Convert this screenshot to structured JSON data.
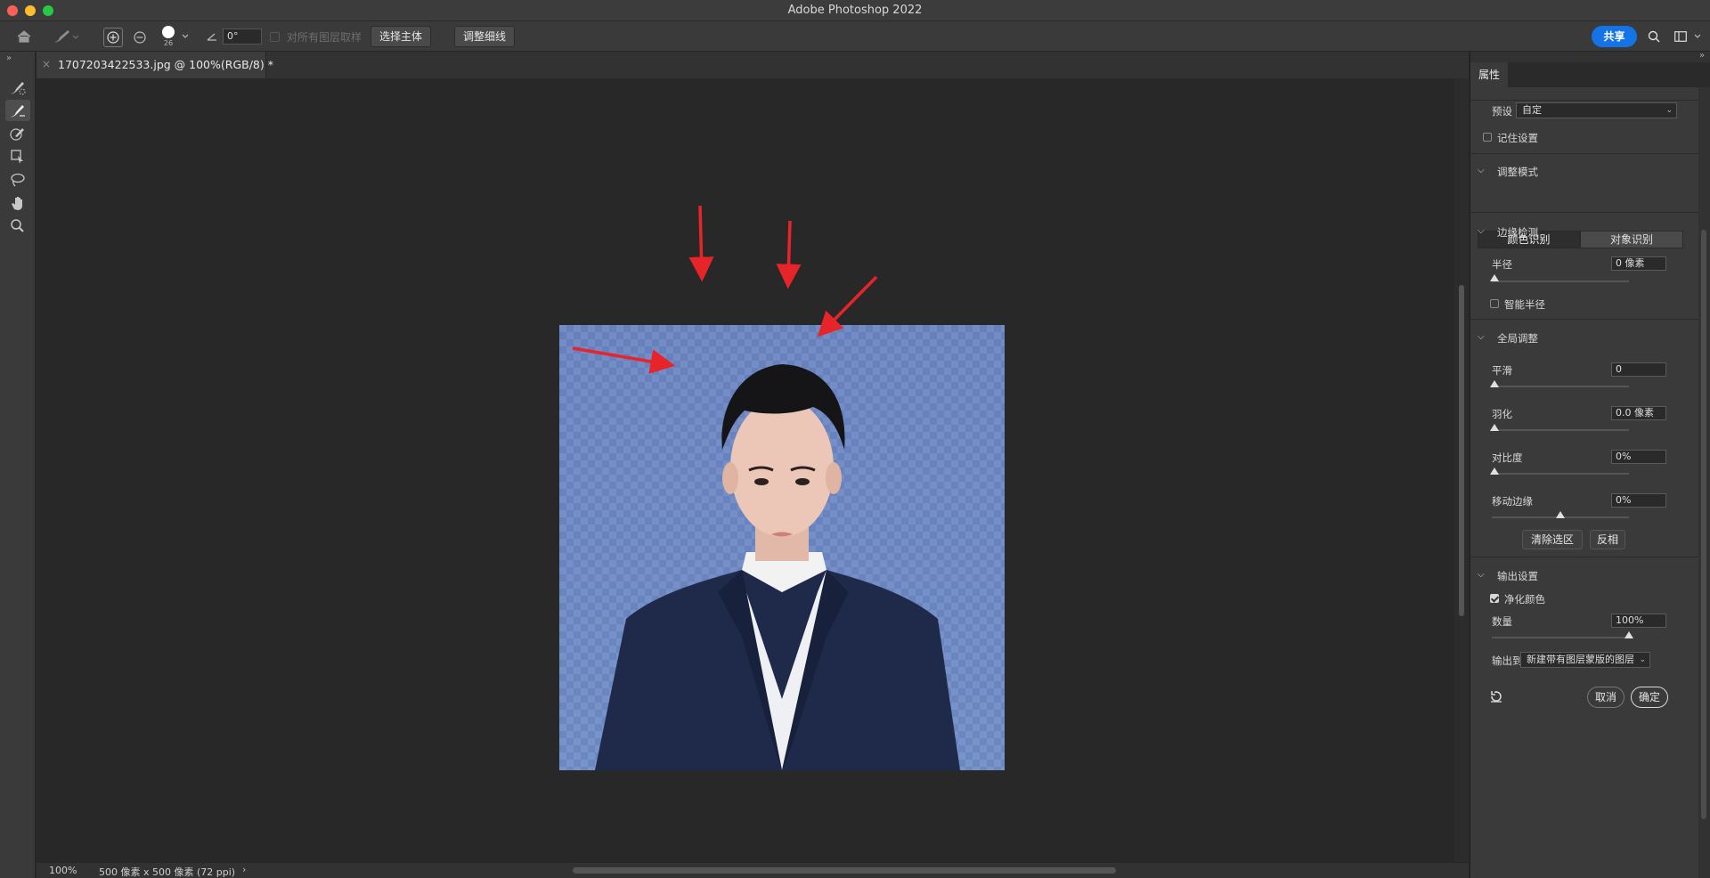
{
  "window": {
    "title": "Adobe Photoshop 2022"
  },
  "options_bar": {
    "brush_size": "26",
    "angle_value": "0°",
    "sample_all_layers": "对所有图层取样",
    "select_subject": "选择主体",
    "refine_hair": "调整细线",
    "share": "共享"
  },
  "document": {
    "tab_title": "1707203422533.jpg @ 100%(RGB/8) *"
  },
  "status": {
    "zoom": "100%",
    "info": "500 像素 x 500 像素 (72 ppi)",
    "arrow": "›"
  },
  "panel": {
    "tab": "属性",
    "preset_label": "预设",
    "preset_value": "自定",
    "remember_label": "记住设置",
    "mode_section": "调整模式",
    "mode_color": "颜色识别",
    "mode_object": "对象识别",
    "edge_section": "边缘检测",
    "radius_label": "半径",
    "radius_value": "0 像素",
    "smart_radius": "智能半径",
    "global_section": "全局调整",
    "smooth_label": "平滑",
    "smooth_value": "0",
    "feather_label": "羽化",
    "feather_value": "0.0 像素",
    "contrast_label": "对比度",
    "contrast_value": "0%",
    "shift_label": "移动边缘",
    "shift_value": "0%",
    "clear_selection": "清除选区",
    "invert": "反相",
    "output_section": "输出设置",
    "decontaminate": "净化颜色",
    "amount_label": "数量",
    "amount_value": "100%",
    "output_to_label": "输出到",
    "output_to_value": "新建带有图层蒙版的图层",
    "cancel": "取消",
    "ok": "确定"
  },
  "sliders": {
    "radius": 0,
    "smooth": 0,
    "feather": 0,
    "contrast": 0,
    "shift_edge": 0.5,
    "amount": 1
  },
  "colors": {
    "accent": "#1473e6",
    "arrow_annotation": "#e8242b"
  }
}
